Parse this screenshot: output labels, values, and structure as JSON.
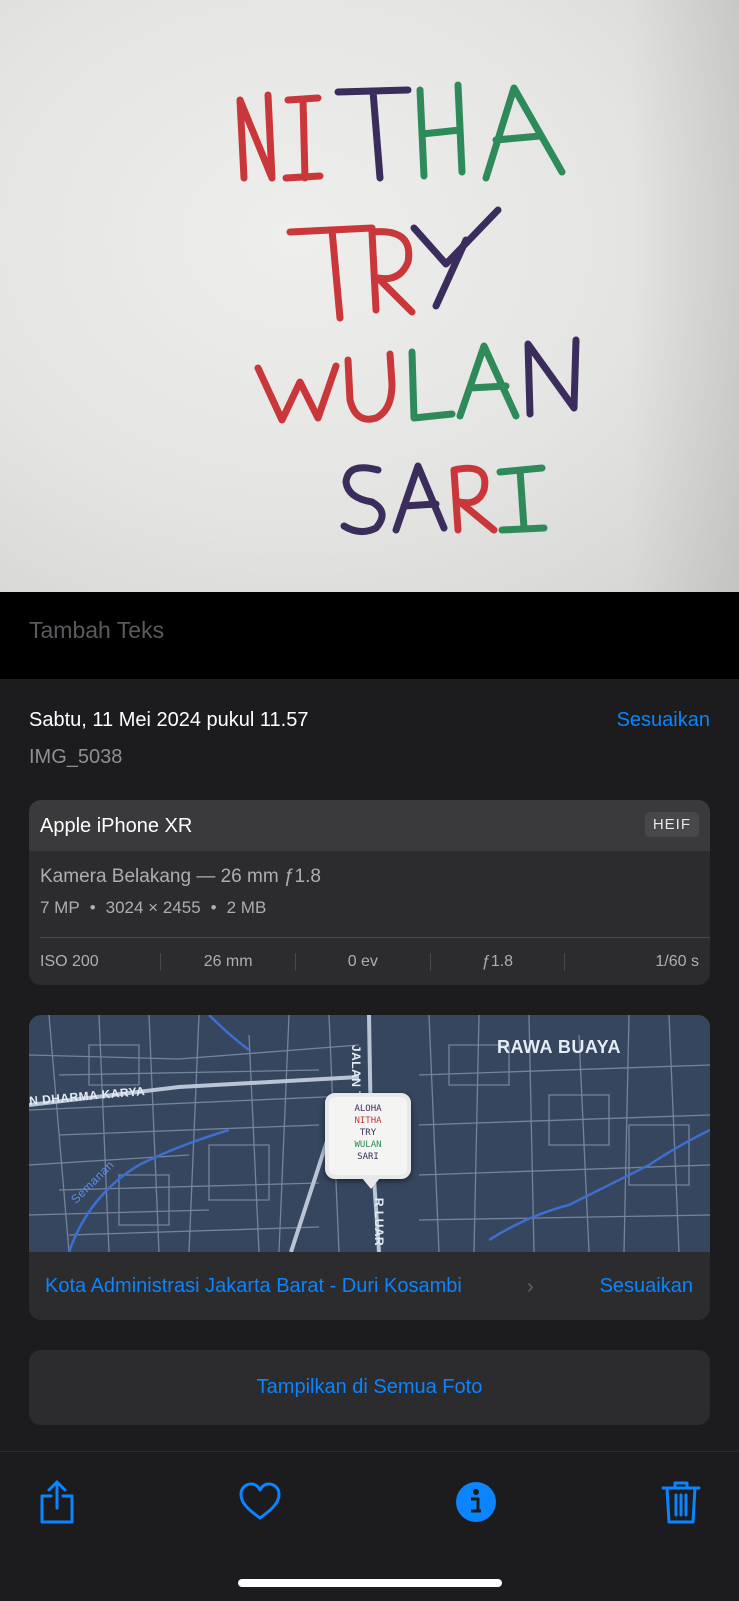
{
  "photo": {
    "handwriting_lines": [
      {
        "text": "NITHA",
        "colors": [
          "#c9373a",
          "#c9373a",
          "#3a2d5c",
          "#2f8a5a",
          "#2f8a5a"
        ]
      },
      {
        "text": "TRY",
        "colors": [
          "#c9373a",
          "#c9373a",
          "#3a2d5c"
        ]
      },
      {
        "text": "WULAN",
        "colors": [
          "#c9373a",
          "#c9373a",
          "#2f8a5a",
          "#2f8a5a",
          "#3a2d5c"
        ]
      },
      {
        "text": "SARI",
        "colors": [
          "#3a2d5c",
          "#3a2d5c",
          "#c9373a",
          "#2f8a5a"
        ]
      }
    ]
  },
  "caption": {
    "placeholder": "Tambah Teks"
  },
  "info": {
    "date": "Sabtu, 11 Mei 2024 pukul 11.57",
    "adjust_label": "Sesuaikan",
    "filename": "IMG_5038"
  },
  "camera": {
    "device": "Apple iPhone XR",
    "format": "HEIF",
    "lens": "Kamera Belakang — 26 mm ƒ1.8",
    "megapixels": "7 MP",
    "resolution": "3024 × 2455",
    "size": "2 MB",
    "exif": {
      "iso": "ISO 200",
      "focal": "26 mm",
      "ev": "0 ev",
      "aperture": "ƒ1.8",
      "shutter": "1/60 s"
    }
  },
  "map": {
    "labels": {
      "area": "RAWA BUAYA",
      "road_west": "N DHARMA KARYA",
      "road_north": "JALAN T",
      "road_south": "R LUAR",
      "river": "Semanan"
    },
    "thumbnail_text": [
      "ALOHA",
      "NITHA",
      "TRY",
      "WULAN",
      "SARI"
    ],
    "location": "Kota Administrasi Jakarta Barat - Duri Kosambi",
    "adjust_label": "Sesuaikan"
  },
  "show_all_label": "Tampilkan di Semua Foto",
  "toolbar": {
    "share_icon": "share-icon",
    "favorite_icon": "heart-icon",
    "info_icon": "info-icon",
    "delete_icon": "trash-icon",
    "accent": "#0a84ff"
  }
}
